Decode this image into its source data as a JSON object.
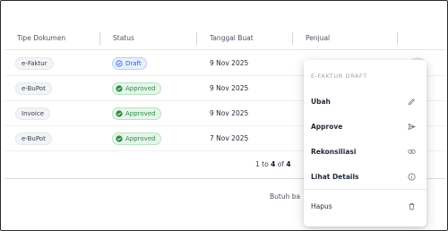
{
  "table": {
    "columns": [
      "Tipe Dokumen",
      "Status",
      "Tanggal Buat",
      "Penjual"
    ],
    "rows": [
      {
        "type": "e-Faktur",
        "status": "Draft",
        "status_kind": "draft",
        "date": "9 Nov 2025"
      },
      {
        "type": "e-BuPot",
        "status": "Approved",
        "status_kind": "approved",
        "date": "9 Nov 2025"
      },
      {
        "type": "Invoice",
        "status": "Approved",
        "status_kind": "approved",
        "date": "9 Nov 2025"
      },
      {
        "type": "e-BuPot",
        "status": "Approved",
        "status_kind": "approved",
        "date": "7 Nov 2025"
      }
    ]
  },
  "pagination": {
    "from": "1",
    "to_word": "to",
    "to": "4",
    "of_word": "of",
    "total": "4"
  },
  "footer": {
    "text": "Butuh ba"
  },
  "menu": {
    "header": "E-FAKTUR DRAFT",
    "items": [
      {
        "label": "Ubah",
        "icon": "pencil-icon"
      },
      {
        "label": "Approve",
        "icon": "send-icon"
      },
      {
        "label": "Rekonsiliasi",
        "icon": "link-icon"
      },
      {
        "label": "Lihat Details",
        "icon": "info-icon"
      },
      {
        "label": "Hapus",
        "icon": "trash-icon"
      }
    ]
  },
  "colors": {
    "draft": "#2563eb",
    "approved": "#2f8a48",
    "icon": "#6b7280"
  }
}
